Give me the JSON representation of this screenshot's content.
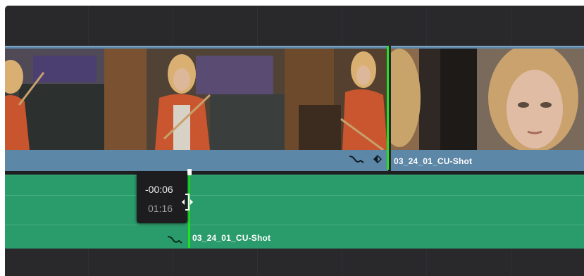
{
  "timeline": {
    "video_clip_label": "03_24_01_CU-Shot",
    "audio_clip_label": "03_24_01_CU-Shot",
    "trim_offset": "-00:06",
    "trim_duration": "01:16"
  },
  "icons": {
    "curve": "curve-icon",
    "keyframe": "keyframe-diamond-icon",
    "trim_cursor": "ripple-trim-cursor-icon"
  },
  "colors": {
    "panel_bg": "#29292c",
    "video_clip": "#5d87a6",
    "audio_clip": "#2a9b6a",
    "edit_point": "#21e021",
    "tooltip_bg": "#1d1d20"
  }
}
